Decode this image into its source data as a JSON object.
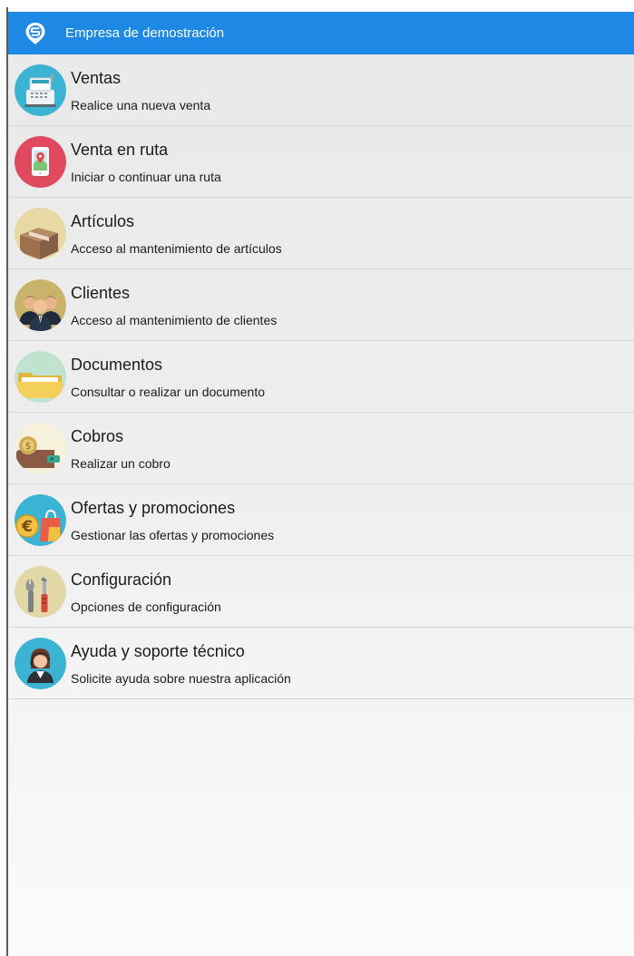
{
  "header": {
    "company_name": "Empresa de demostración",
    "icon": "app-logo-icon",
    "color": "#1e88e5"
  },
  "menu": {
    "items": [
      {
        "id": "ventas",
        "title": "Ventas",
        "subtitle": "Realice una nueva venta",
        "icon": "cash-register-icon",
        "color": "#3bb3d3"
      },
      {
        "id": "venta-en-ruta",
        "title": "Venta en ruta",
        "subtitle": "Iniciar o continuar una ruta",
        "icon": "map-phone-icon",
        "color": "#e04a5f"
      },
      {
        "id": "articulos",
        "title": "Artículos",
        "subtitle": "Acceso al mantenimiento de artículos",
        "icon": "box-icon",
        "color": "#e8d9a4"
      },
      {
        "id": "clientes",
        "title": "Clientes",
        "subtitle": "Acceso al mantenimiento de clientes",
        "icon": "people-icon",
        "color": "#c9b36a"
      },
      {
        "id": "documentos",
        "title": "Documentos",
        "subtitle": "Consultar o realizar un documento",
        "icon": "folder-icon",
        "color": "#bfe3cf"
      },
      {
        "id": "cobros",
        "title": "Cobros",
        "subtitle": "Realizar un cobro",
        "icon": "coin-wallet-icon",
        "color": "#f6f1da"
      },
      {
        "id": "ofertas",
        "title": "Ofertas y promociones",
        "subtitle": "Gestionar las ofertas y promociones",
        "icon": "euro-shopping-icon",
        "color": "#3bb3d3"
      },
      {
        "id": "configuracion",
        "title": "Configuración",
        "subtitle": "Opciones de configuración",
        "icon": "tools-icon",
        "color": "#e2d7a6"
      },
      {
        "id": "ayuda",
        "title": "Ayuda y soporte técnico",
        "subtitle": "Solicite ayuda sobre nuestra aplicación",
        "icon": "support-agent-icon",
        "color": "#3bb3d3"
      }
    ]
  }
}
